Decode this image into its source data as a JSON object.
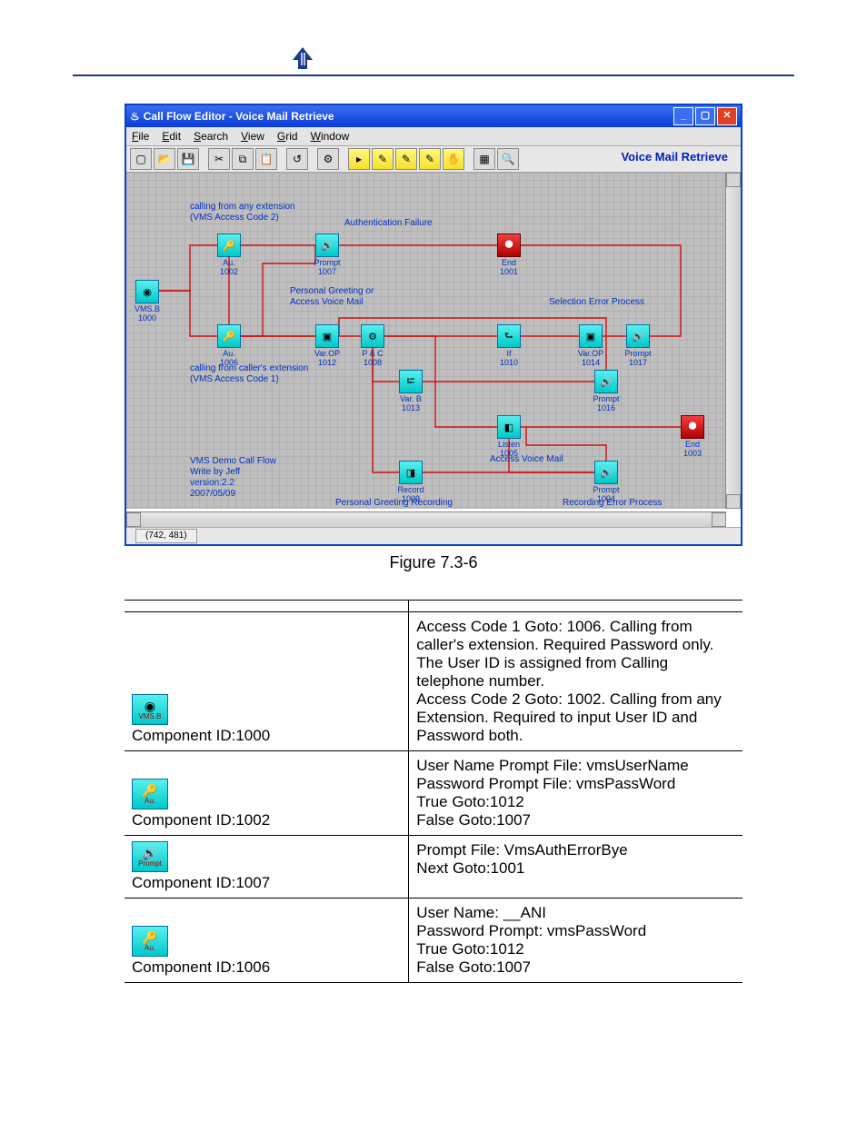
{
  "header": {
    "arrow_color": "#1a3a8a"
  },
  "screenshot": {
    "title": "Call Flow Editor - Voice Mail Retrieve",
    "menus": [
      "File",
      "Edit",
      "Search",
      "View",
      "Grid",
      "Window"
    ],
    "toolbar_label": "Voice Mail Retrieve",
    "status": "(742, 481)",
    "annotations": {
      "a1_line1": "calling from any extension",
      "a1_line2": "(VMS Access Code 2)",
      "a2": "Authentication Failure",
      "a3_line1": "Personal Greeting or",
      "a3_line2": "Access Voice Mail",
      "a4": "Selection Error Process",
      "a5_line1": "calling from caller's extension",
      "a5_line2": "(VMS Access Code 1)",
      "a6": "Access Voice Mail",
      "a7": "Personal Greeting Recording",
      "a8": "Recording Error Process",
      "meta_l1": "VMS Demo Call Flow",
      "meta_l2": "Write by Jeff",
      "meta_l3": "version:2.2",
      "meta_l4": "2007/05/09"
    },
    "nodes": {
      "n1000": {
        "id": "1000",
        "label": "VMS.B",
        "sym": "◉"
      },
      "n1002": {
        "id": "1002",
        "label": "Au.",
        "sym": "🔑"
      },
      "n1007": {
        "id": "1007",
        "label": "Prompt",
        "sym": "🔊"
      },
      "n1001": {
        "id": "1001",
        "label": "End",
        "sym": "⯃"
      },
      "n1006": {
        "id": "1006",
        "label": "Au.",
        "sym": "🔑"
      },
      "n1012": {
        "id": "1012",
        "label": "Var.OP",
        "sym": "▣"
      },
      "n1008": {
        "id": "1008",
        "label": "P & C",
        "sym": "⚙"
      },
      "n1010": {
        "id": "1010",
        "label": "If",
        "sym": "⮑"
      },
      "n1014": {
        "id": "1014",
        "label": "Var.OP",
        "sym": "▣"
      },
      "n1017": {
        "id": "1017",
        "label": "Prompt",
        "sym": "🔊"
      },
      "n1013": {
        "id": "1013",
        "label": "Var. B",
        "sym": "⮓"
      },
      "n1016": {
        "id": "1016",
        "label": "Prompt",
        "sym": "🔊"
      },
      "n1005": {
        "id": "1005",
        "label": "Listen",
        "sym": "◧"
      },
      "n1003": {
        "id": "1003",
        "label": "End",
        "sym": "⯃"
      },
      "n1009": {
        "id": "1009",
        "label": "Record",
        "sym": "◨"
      },
      "n1004": {
        "id": "1004",
        "label": "Prompt",
        "sym": "🔊"
      }
    }
  },
  "figure_caption": "Figure 7.3-6",
  "table": {
    "rows": [
      {
        "icon_label": "VMS.B",
        "icon_sym": "◉",
        "left": "Component ID:1000",
        "right": "Access Code 1 Goto: 1006. Calling from caller's extension. Required Password only. The User ID is assigned from Calling telephone number.\nAccess Code 2 Goto: 1002. Calling from any Extension. Required to input User ID and Password both."
      },
      {
        "icon_label": "Au.",
        "icon_sym": "🔑",
        "left": "Component ID:1002",
        "right": "User Name Prompt File: vmsUserName\nPassword Prompt File: vmsPassWord\nTrue Goto:1012\nFalse Goto:1007"
      },
      {
        "icon_label": "Prompt",
        "icon_sym": "🔊",
        "left": "Component ID:1007",
        "right": "Prompt File: VmsAuthErrorBye\nNext Goto:1001"
      },
      {
        "icon_label": "Au.",
        "icon_sym": "🔑",
        "left": "Component ID:1006",
        "right": "User Name: __ANI\nPassword Prompt: vmsPassWord\nTrue Goto:1012\nFalse Goto:1007"
      }
    ]
  }
}
